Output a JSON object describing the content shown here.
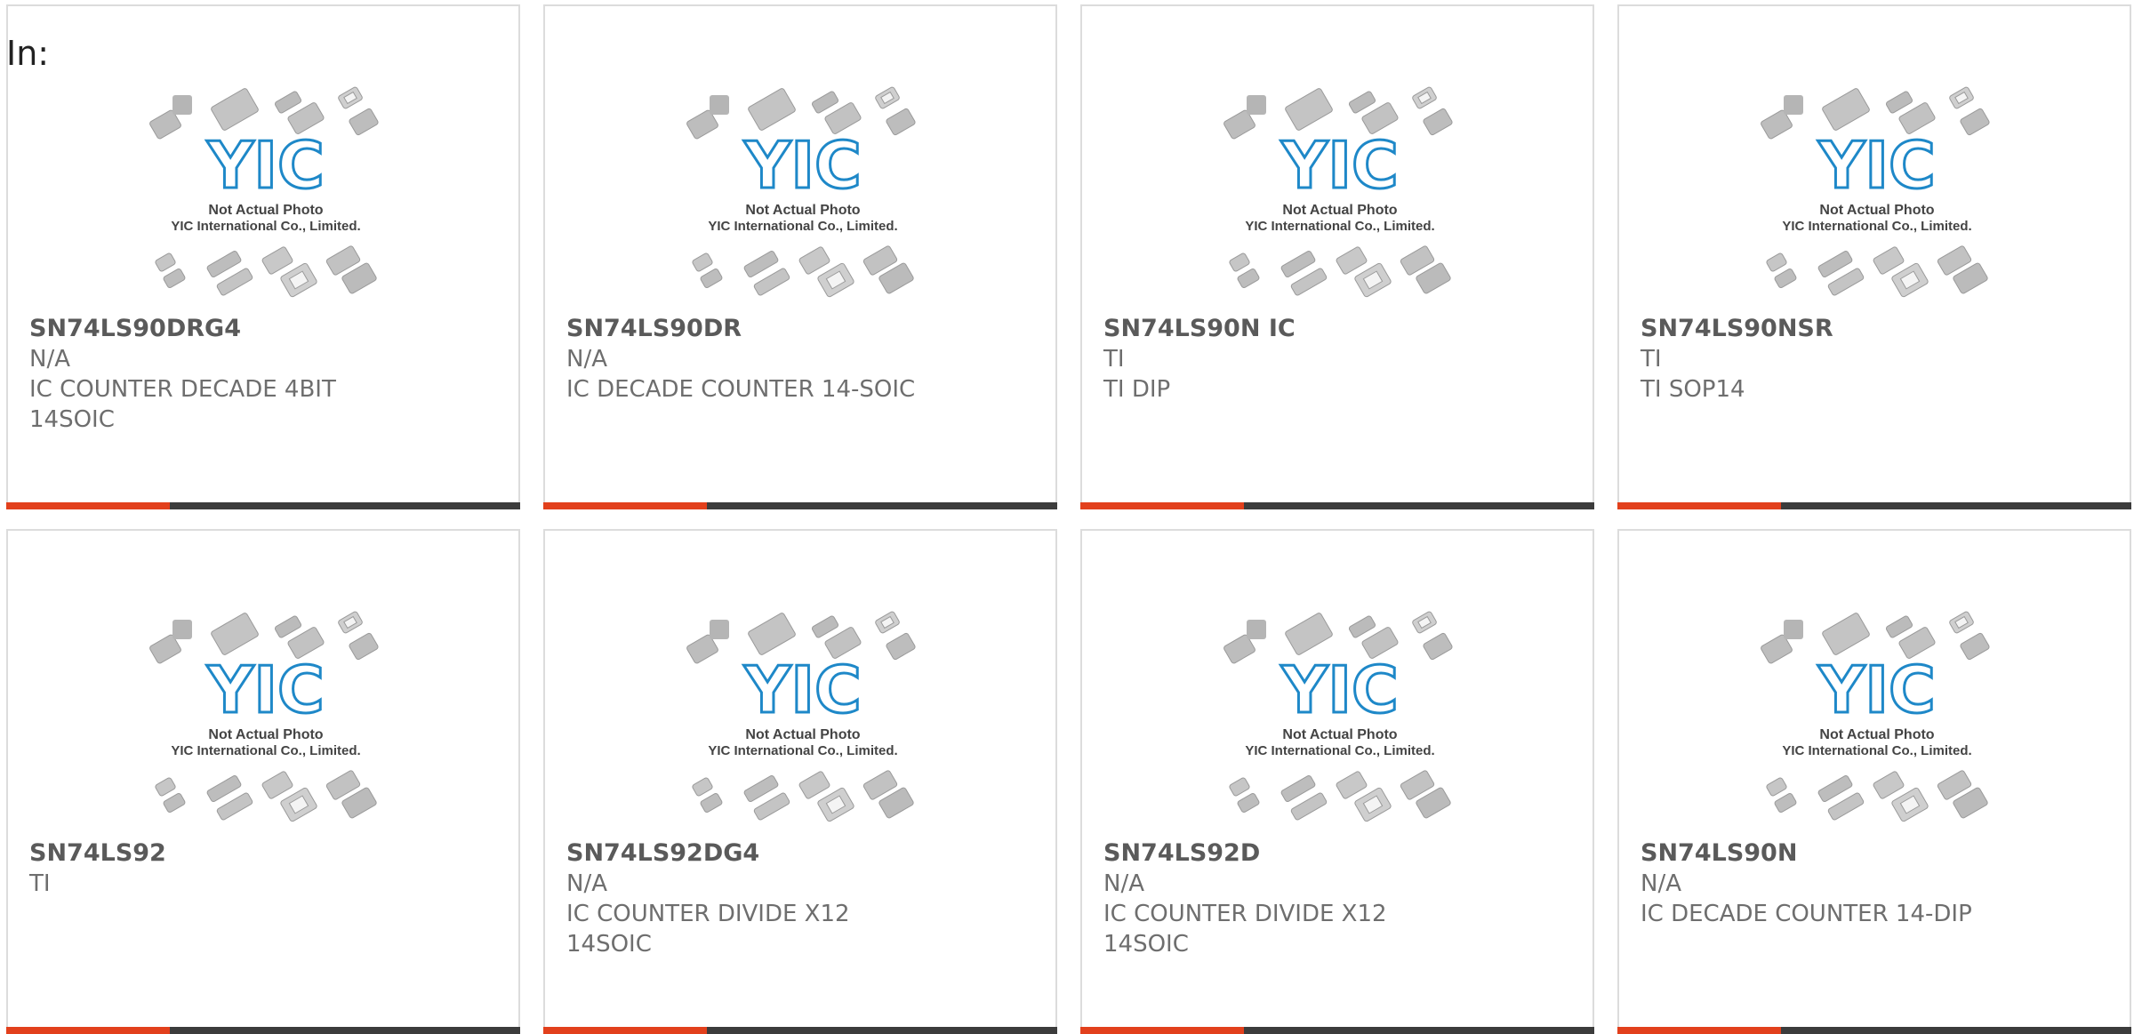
{
  "page": {
    "label": "In:"
  },
  "thumbnail": {
    "logo_text": "YIC",
    "caption_line1": "Not Actual Photo",
    "caption_line2": "YIC International Co., Limited."
  },
  "colors": {
    "accent": "#e2401c",
    "bar": "#3c3c3c",
    "logo": "#1e88c8",
    "text": "#5a5a5a"
  },
  "products": [
    {
      "part_number": "SN74LS90DRG4",
      "manufacturer": "N/A",
      "description": "IC COUNTER DECADE 4BIT 14SOIC"
    },
    {
      "part_number": "SN74LS90DR",
      "manufacturer": "N/A",
      "description": "IC DECADE COUNTER 14-SOIC"
    },
    {
      "part_number": "SN74LS90N IC",
      "manufacturer": "TI",
      "description": "TI DIP"
    },
    {
      "part_number": "SN74LS90NSR",
      "manufacturer": "TI",
      "description": "TI SOP14"
    },
    {
      "part_number": "SN74LS92",
      "manufacturer": "TI",
      "description": ""
    },
    {
      "part_number": "SN74LS92DG4",
      "manufacturer": "N/A",
      "description": "IC COUNTER DIVIDE X12 14SOIC"
    },
    {
      "part_number": "SN74LS92D",
      "manufacturer": "N/A",
      "description": "IC COUNTER DIVIDE X12 14SOIC"
    },
    {
      "part_number": "SN74LS90N",
      "manufacturer": "N/A",
      "description": "IC DECADE COUNTER 14-DIP"
    }
  ]
}
